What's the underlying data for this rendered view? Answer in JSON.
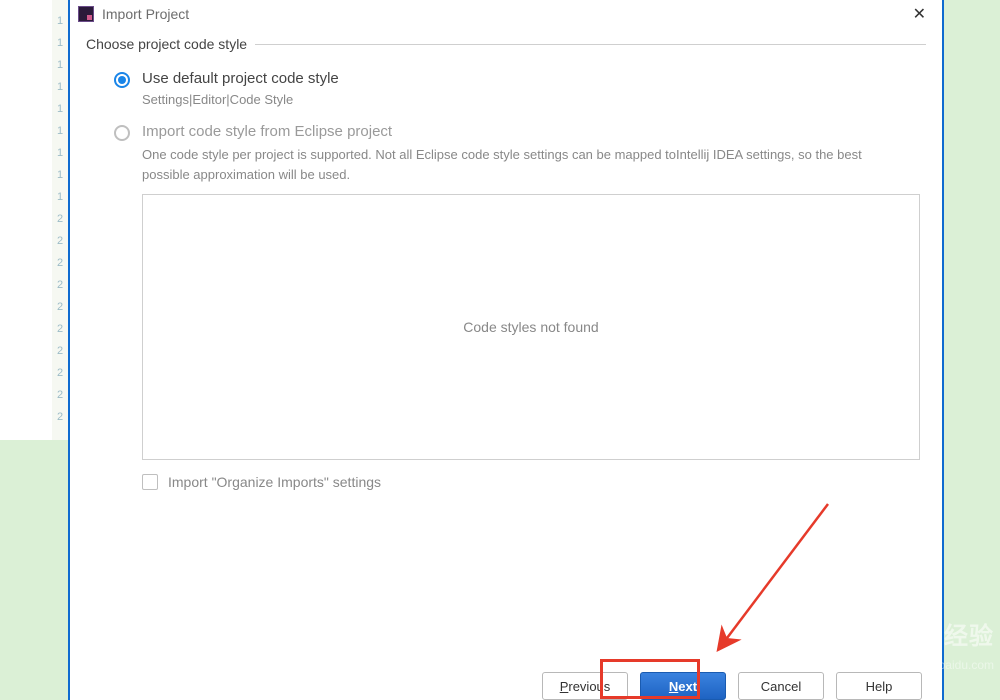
{
  "window": {
    "title": "Import Project"
  },
  "section": {
    "header": "Choose project code style"
  },
  "options": {
    "default_label": "Use default project code style",
    "default_sub": "Settings|Editor|Code Style",
    "eclipse_label": "Import code style from Eclipse project",
    "eclipse_desc": "One code style per project is supported. Not all Eclipse code style settings can be mapped toIntellij IDEA settings, so the best possible approximation will be used.",
    "list_empty": "Code styles not found",
    "organize_label": "Import \"Organize Imports\" settings"
  },
  "buttons": {
    "previous_pre": "P",
    "previous_rest": "revious",
    "next_pre": "N",
    "next_rest": "ext",
    "cancel": "Cancel",
    "help": "Help"
  },
  "watermark": {
    "brand": "Baidu 经验",
    "url": "jingyan.baidu.com"
  }
}
